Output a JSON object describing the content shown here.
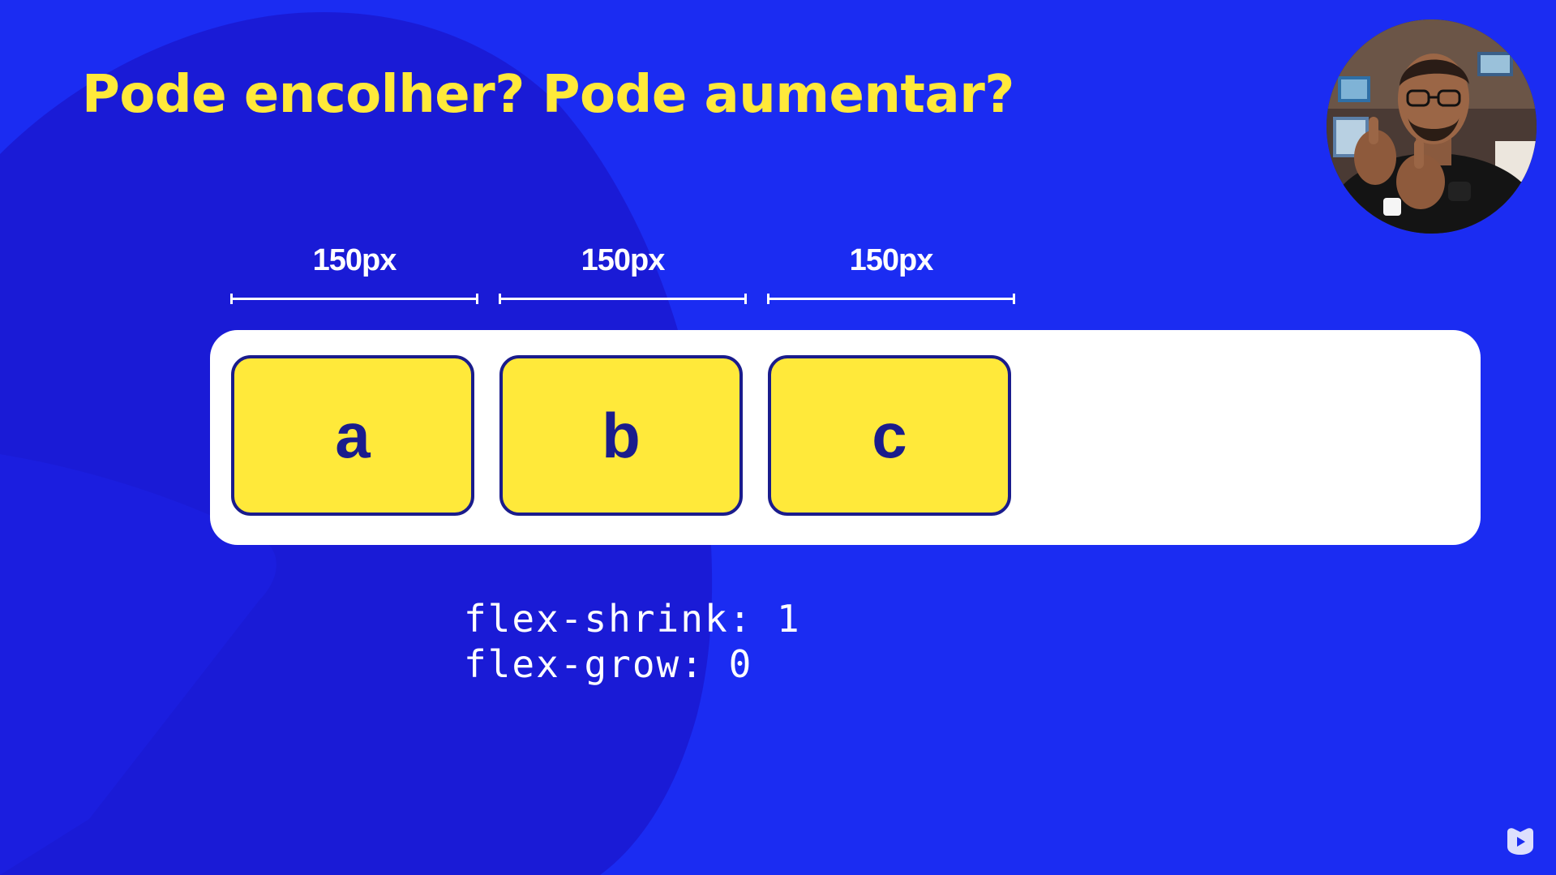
{
  "title": "Pode encolher? Pode aumentar?",
  "measures": [
    {
      "label": "150px"
    },
    {
      "label": "150px"
    },
    {
      "label": "150px"
    }
  ],
  "flex_items": [
    {
      "label": "a"
    },
    {
      "label": "b"
    },
    {
      "label": "c"
    }
  ],
  "code": {
    "line1": "flex-shrink: 1",
    "line2": "flex-grow: 0"
  },
  "colors": {
    "background": "#1b2cf2",
    "blob": "#1a1bd6",
    "title": "#ffe93a",
    "item_fill": "#ffe93a",
    "item_border": "#1a1c8c",
    "container": "#ffffff",
    "text_light": "#ffffff"
  },
  "icons": {
    "presenter": "presenter-webcam-avatar",
    "channel_logo": "video-play-logo-icon"
  }
}
